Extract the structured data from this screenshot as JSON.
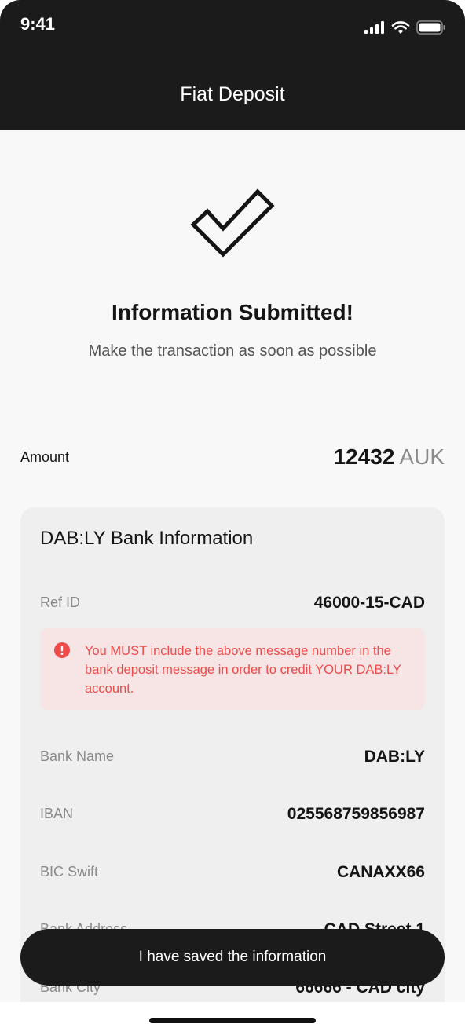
{
  "status_bar": {
    "time": "9:41",
    "icons": [
      "signal-icon",
      "wifi-icon",
      "battery-icon"
    ]
  },
  "header": {
    "title": "Fiat Deposit"
  },
  "success": {
    "icon": "checkmark-icon",
    "title": "Information Submitted!",
    "subtitle": "Make the transaction as soon as possible"
  },
  "amount": {
    "label": "Amount",
    "value": "12432",
    "currency": "AUK"
  },
  "bank_info": {
    "title": "DAB:LY Bank Information",
    "ref_id": {
      "label": "Ref ID",
      "value": "46000-15-CAD"
    },
    "warning": {
      "icon": "alert-icon",
      "text": "You MUST include the above message number in the bank deposit message in order to credit YOUR DAB:LY account."
    },
    "rows": [
      {
        "label": "Bank Name",
        "value": "DAB:LY"
      },
      {
        "label": "IBAN",
        "value": "025568759856987"
      },
      {
        "label": "BIC Swift",
        "value": "CANAXX66"
      },
      {
        "label": "Bank Address",
        "value": "CAD Street 1"
      },
      {
        "label": "Bank City",
        "value": "66666 - CAD city"
      }
    ]
  },
  "actions": {
    "save_label": "I have saved the information"
  },
  "colors": {
    "header_bg": "#1b1b1b",
    "warning_text": "#ee4b4b",
    "warning_bg": "#f7e4e4"
  }
}
